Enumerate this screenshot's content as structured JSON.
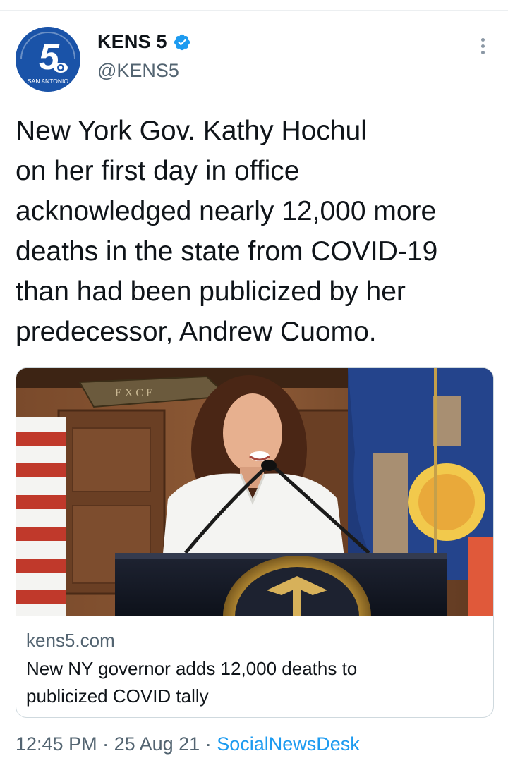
{
  "tweet": {
    "account": {
      "display_name": "KENS 5",
      "handle": "@KENS5",
      "verified": true,
      "avatar": {
        "logo_number": "5",
        "logo_caption": "SAN ANTONIO",
        "brand_color": "#1a53a8",
        "icon": "kens5-logo"
      }
    },
    "text": "New York Gov. Kathy Hochul\non her first day in office\nacknowledged nearly 12,000 more\ndeaths in the state from COVID-19\nthan had been publicized by her\npredecessor, Andrew Cuomo.",
    "link_card": {
      "image_description": "woman at a podium in front of a US flag and New York state flag",
      "image_sign_text": "EXCE",
      "domain": "kens5.com",
      "title": "New NY governor adds 12,000 deaths to\npublicized COVID tally"
    },
    "meta": {
      "time": "12:45 PM",
      "separator": " · ",
      "date": "25 Aug 21",
      "source": "SocialNewsDesk"
    }
  },
  "colors": {
    "accent": "#1d9bf0",
    "text": "#0f1419",
    "secondary": "#536471",
    "border": "#cfd9de"
  }
}
